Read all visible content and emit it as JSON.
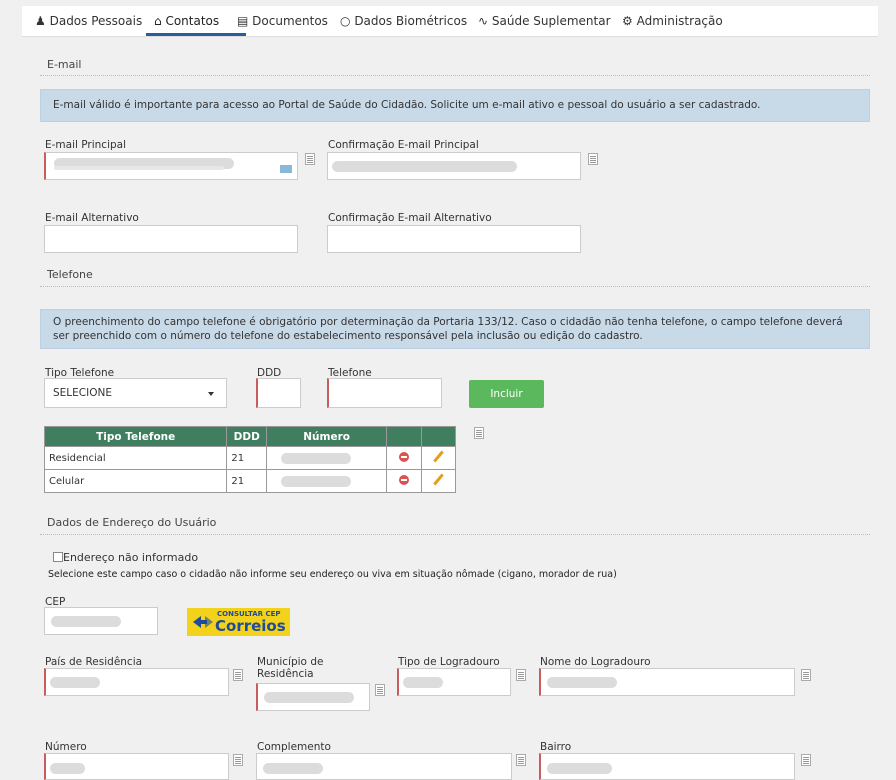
{
  "tabs": [
    {
      "label": "Dados Pessoais",
      "icon": "user-icon"
    },
    {
      "label": "Contatos",
      "icon": "home-icon"
    },
    {
      "label": "Documentos",
      "icon": "document-icon"
    },
    {
      "label": "Dados Biométricos",
      "icon": "fingerprint-icon"
    },
    {
      "label": "Saúde Suplementar",
      "icon": "heartbeat-icon"
    },
    {
      "label": "Administração",
      "icon": "gear-icon"
    }
  ],
  "email": {
    "section_title": "E-mail",
    "info": "E-mail válido é importante para acesso ao Portal de Saúde do Cidadão. Solicite um e-mail ativo e pessoal do usuário a ser cadastrado.",
    "principal_label": "E-mail Principal",
    "confirm_principal_label": "Confirmação E-mail Principal",
    "alternativo_label": "E-mail Alternativo",
    "confirm_alternativo_label": "Confirmação E-mail Alternativo"
  },
  "telefone": {
    "section_title": "Telefone",
    "info": "O preenchimento do campo telefone é obrigatório por determinação da Portaria 133/12. Caso o cidadão não tenha telefone, o campo telefone deverá ser preenchido com o número do telefone do estabelecimento responsável pela inclusão ou edição do cadastro.",
    "tipo_label": "Tipo Telefone",
    "tipo_value": "SELECIONE",
    "ddd_label": "DDD",
    "telefone_label": "Telefone",
    "incluir_label": "Incluir",
    "table_headers": [
      "Tipo Telefone",
      "DDD",
      "Número"
    ],
    "rows": [
      {
        "tipo": "Residencial",
        "ddd": "21"
      },
      {
        "tipo": "Celular",
        "ddd": "21"
      }
    ]
  },
  "endereco": {
    "section_title": "Dados de Endereço do Usuário",
    "nao_informado_label": "Endereço não informado",
    "nao_informado_hint": "Selecione este campo caso o cidadão não informe seu endereço ou viva em situação nômade (cigano, morador de rua)",
    "cep_label": "CEP",
    "correios_top": "CONSULTAR CEP",
    "correios_main": "Correios",
    "pais_label": "País de Residência",
    "municipio_label": "Município de Residência",
    "tipo_logradouro_label": "Tipo de Logradouro",
    "nome_logradouro_label": "Nome do Logradouro",
    "numero_label": "Número",
    "complemento_label": "Complemento",
    "bairro_label": "Bairro"
  }
}
